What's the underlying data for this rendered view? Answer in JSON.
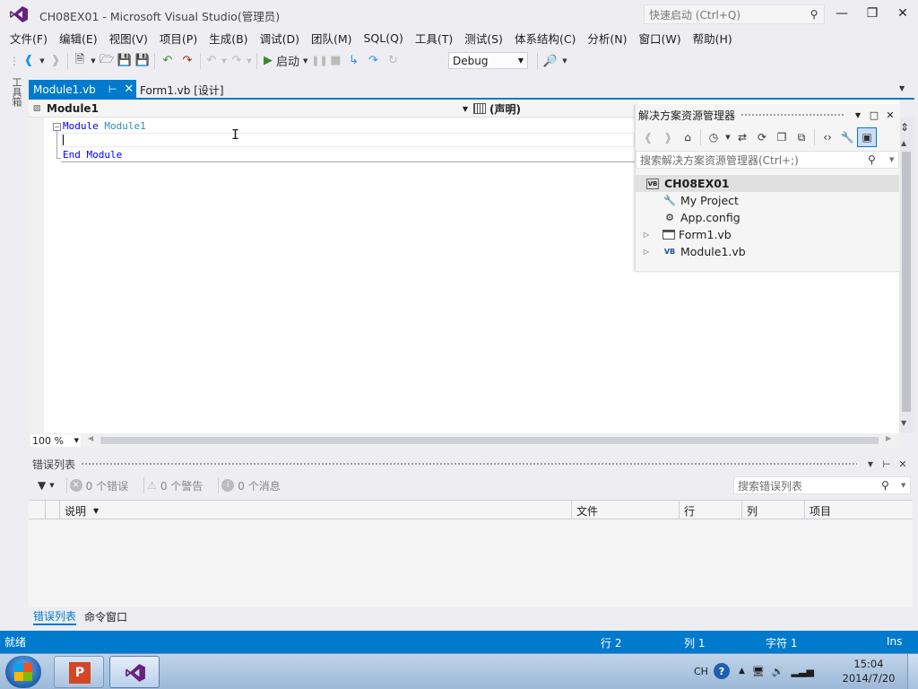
{
  "window": {
    "title": "CH08EX01 - Microsoft Visual Studio(管理员)",
    "quick_launch_placeholder": "快速启动 (Ctrl+Q)"
  },
  "menu": [
    "文件(F)",
    "编辑(E)",
    "视图(V)",
    "项目(P)",
    "生成(B)",
    "调试(D)",
    "团队(M)",
    "SQL(Q)",
    "工具(T)",
    "测试(S)",
    "体系结构(C)",
    "分析(N)",
    "窗口(W)",
    "帮助(H)"
  ],
  "toolbar": {
    "start_label": "启动",
    "config": "Debug"
  },
  "toolbox_label": "工具箱",
  "tabs": {
    "active": "Module1.vb",
    "inactive": "Form1.vb [设计]"
  },
  "navbar": {
    "left": "Module1",
    "right": "(声明)"
  },
  "code": {
    "line1_kw": "Module",
    "line1_name": "Module1",
    "line3": "End Module"
  },
  "zoom": "100 %",
  "solution_explorer": {
    "title": "解决方案资源管理器",
    "search_placeholder": "搜索解决方案资源管理器(Ctrl+;)",
    "root": "CH08EX01",
    "items": [
      {
        "label": "My Project",
        "icon": "wrench-icon",
        "expandable": false
      },
      {
        "label": "App.config",
        "icon": "config-icon",
        "expandable": false
      },
      {
        "label": "Form1.vb",
        "icon": "form-icon",
        "expandable": true
      },
      {
        "label": "Module1.vb",
        "icon": "vb-file-icon",
        "expandable": true
      }
    ]
  },
  "error_list": {
    "title": "错误列表",
    "errors": "0 个错误",
    "warnings": "0 个警告",
    "messages": "0 个消息",
    "search_placeholder": "搜索错误列表",
    "columns": [
      "说明",
      "文件",
      "行",
      "列",
      "项目"
    ]
  },
  "bottom_tabs": [
    "错误列表",
    "命令窗口"
  ],
  "status": {
    "ready": "就绪",
    "row": "行 2",
    "col": "列 1",
    "char": "字符 1",
    "mode": "Ins"
  },
  "taskbar": {
    "lang": "CH",
    "time": "15:04",
    "date": "2014/7/20"
  },
  "colors": {
    "accent": "#007ACC",
    "keyword": "#0000FF",
    "type_name": "#2B91AF"
  }
}
